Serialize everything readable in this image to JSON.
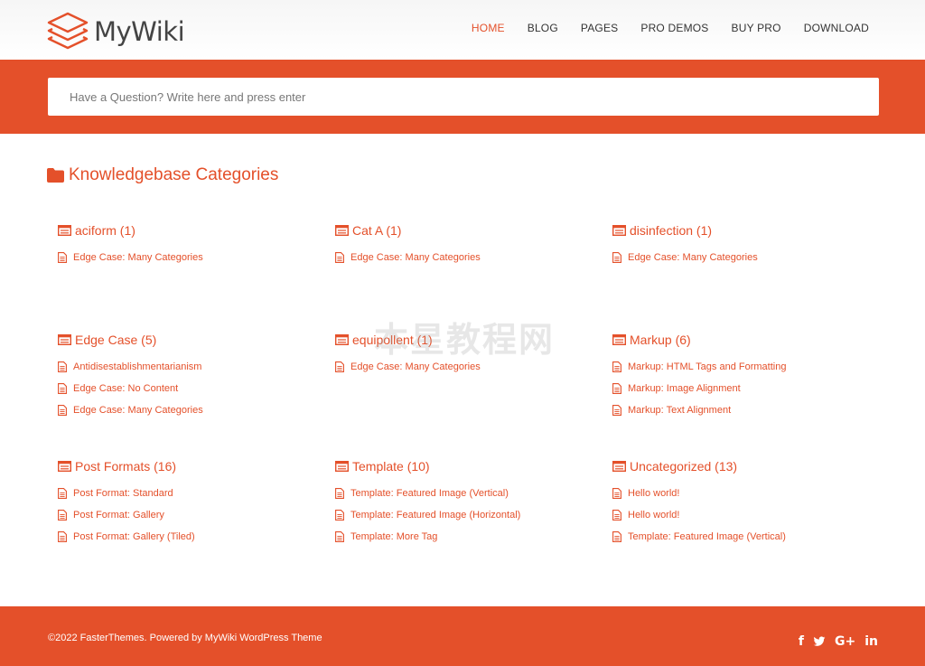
{
  "site": {
    "logo_text": "MyWiki"
  },
  "nav": {
    "items": [
      {
        "label": "HOME",
        "active": true
      },
      {
        "label": "BLOG"
      },
      {
        "label": "PAGES"
      },
      {
        "label": "PRO DEMOS"
      },
      {
        "label": "BUY PRO"
      },
      {
        "label": "DOWNLOAD"
      }
    ]
  },
  "search": {
    "placeholder": "Have a Question? Write here and press enter"
  },
  "section": {
    "title": "Knowledgebase Categories"
  },
  "categories": [
    {
      "title": "aciform (1)",
      "posts": [
        "Edge Case: Many Categories"
      ]
    },
    {
      "title": "Cat A (1)",
      "posts": [
        "Edge Case: Many Categories"
      ]
    },
    {
      "title": "disinfection (1)",
      "posts": [
        "Edge Case: Many Categories"
      ]
    },
    {
      "title": "Edge Case (5)",
      "posts": [
        "Antidisestablishmentarianism",
        "Edge Case: No Content",
        "Edge Case: Many Categories"
      ]
    },
    {
      "title": "equipollent (1)",
      "posts": [
        "Edge Case: Many Categories"
      ]
    },
    {
      "title": "Markup (6)",
      "posts": [
        "Markup: HTML Tags and Formatting",
        "Markup: Image Alignment",
        "Markup: Text Alignment"
      ]
    },
    {
      "title": "Post Formats (16)",
      "posts": [
        "Post Format: Standard",
        "Post Format: Gallery",
        "Post Format: Gallery (Tiled)"
      ]
    },
    {
      "title": "Template (10)",
      "posts": [
        "Template: Featured Image (Vertical)",
        "Template: Featured Image (Horizontal)",
        "Template: More Tag"
      ]
    },
    {
      "title": "Uncategorized (13)",
      "posts": [
        "Hello world!",
        "Hello world!",
        "Template: Featured Image (Vertical)"
      ]
    }
  ],
  "watermark": "本星教程网",
  "footer": {
    "copyright": "©2022 FasterThemes. Powered by MyWiki WordPress Theme",
    "social": [
      {
        "icon": "facebook-icon",
        "glyph": "f"
      },
      {
        "icon": "twitter-icon",
        "glyph": ""
      },
      {
        "icon": "google-plus-icon",
        "glyph": "G+"
      },
      {
        "icon": "linkedin-icon",
        "glyph": "in"
      }
    ]
  },
  "colors": {
    "accent": "#e4502a",
    "nav_text": "#333333",
    "logo_text": "#444444"
  }
}
